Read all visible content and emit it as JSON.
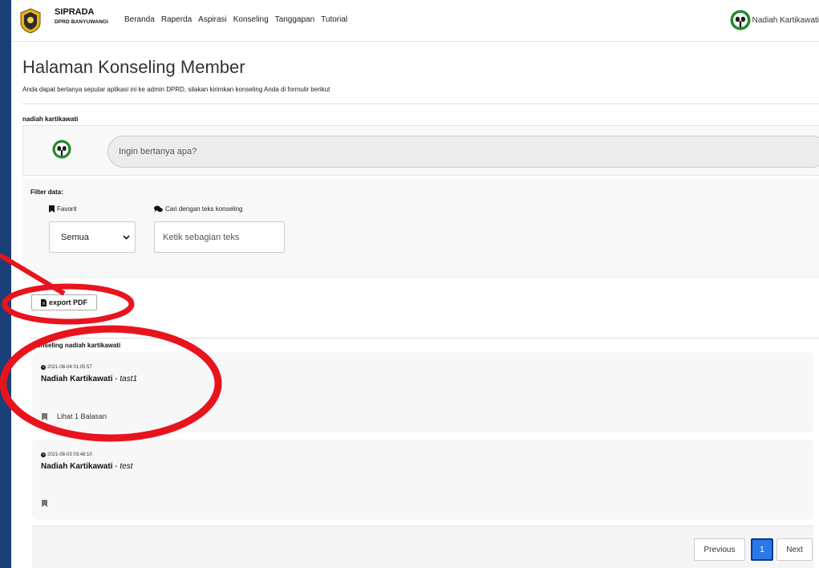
{
  "navbar": {
    "brand_title": "SIPRADA",
    "brand_sub": "DPRD BANYUWANGI",
    "links": [
      "Beranda",
      "Raperda",
      "Aspirasi",
      "Konseling",
      "Tanggapan",
      "Tutorial"
    ],
    "user_name": "Nadiah Kartikawati"
  },
  "page": {
    "title": "Halaman Konseling Member",
    "description": "Anda dapat bertanya seputar aplikasi ini ke admin DPRD, silakan kirimkan konseling Anda di formulir berikut",
    "member_name": "nadiah kartikawati"
  },
  "ask": {
    "placeholder": "Ingin bertanya apa?"
  },
  "filter": {
    "title": "Filter data:",
    "favorite_label": "Favorit",
    "favorite_selected": "Semua",
    "search_label": "Cari dengan teks konseling",
    "search_placeholder": "Ketik sebagian teks"
  },
  "export_label": "export PDF",
  "section_title": "Konseling nadiah kartikawati",
  "posts": [
    {
      "date": "2021-08-04 01:05:57",
      "author": "Nadiah Kartikawati",
      "separator": " - ",
      "subject": "tast1",
      "replies_label": "Lihat 1 Balasan"
    },
    {
      "date": "2021-08-03 03:48:10",
      "author": "Nadiah Kartikawati",
      "separator": " - ",
      "subject": "test",
      "replies_label": ""
    }
  ],
  "pagination": {
    "previous": "Previous",
    "current": "1",
    "next": "Next"
  },
  "colors": {
    "accent": "#2979e6",
    "annotation": "#e8141d",
    "page_background": "#1b3f78"
  },
  "icons": [
    "logo-icon",
    "avatar-icon",
    "bookmark-icon",
    "comments-icon",
    "chevron-down-icon",
    "pdf-icon",
    "clock-icon"
  ]
}
